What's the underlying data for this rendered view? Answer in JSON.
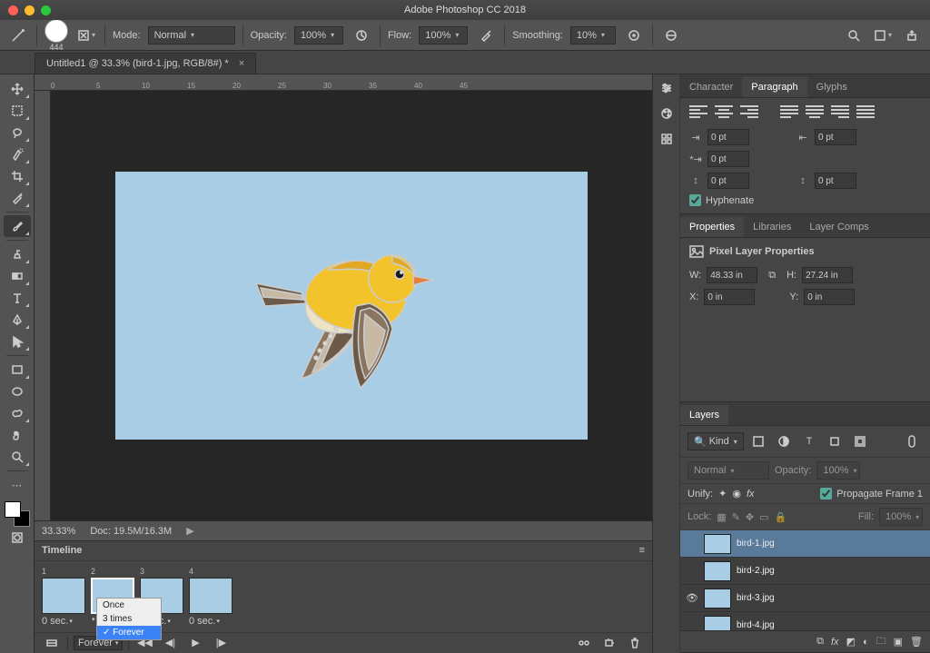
{
  "app": {
    "title": "Adobe Photoshop CC 2018"
  },
  "document": {
    "tab_title": "Untitled1 @ 33.3% (bird-1.jpg, RGB/8#) *"
  },
  "options": {
    "brush_size": "444",
    "mode_label": "Mode:",
    "mode_value": "Normal",
    "opacity_label": "Opacity:",
    "opacity_value": "100%",
    "flow_label": "Flow:",
    "flow_value": "100%",
    "smoothing_label": "Smoothing:",
    "smoothing_value": "10%"
  },
  "ruler_marks": [
    "0",
    "5",
    "10",
    "15",
    "20",
    "25",
    "30",
    "35",
    "40",
    "45"
  ],
  "status": {
    "zoom": "33.33%",
    "doc": "Doc: 19.5M/16.3M"
  },
  "timeline": {
    "title": "Timeline",
    "frames": [
      {
        "n": "1",
        "dur": "0 sec."
      },
      {
        "n": "2",
        "dur": ""
      },
      {
        "n": "3",
        "dur": "0 sec."
      },
      {
        "n": "4",
        "dur": "0 sec."
      }
    ],
    "loop_options": [
      "Once",
      "3 times",
      "Forever"
    ],
    "loop_selected": "Forever"
  },
  "paragraph": {
    "tab_character": "Character",
    "tab_paragraph": "Paragraph",
    "tab_glyphs": "Glyphs",
    "indent_left": "0 pt",
    "indent_right": "0 pt",
    "indent_first": "0 pt",
    "space_before": "0 pt",
    "space_after": "0 pt",
    "hyphenate_label": "Hyphenate"
  },
  "properties": {
    "tab_properties": "Properties",
    "tab_libraries": "Libraries",
    "tab_layer_comps": "Layer Comps",
    "header": "Pixel Layer Properties",
    "w_label": "W:",
    "w_value": "48.33 in",
    "h_label": "H:",
    "h_value": "27.24 in",
    "x_label": "X:",
    "x_value": "0 in",
    "y_label": "Y:",
    "y_value": "0 in"
  },
  "layers": {
    "title": "Layers",
    "filter": "Kind",
    "blend": "Normal",
    "opacity_label": "Opacity:",
    "opacity_value": "100%",
    "unify_label": "Unify:",
    "propagate_label": "Propagate Frame 1",
    "lock_label": "Lock:",
    "fill_label": "Fill:",
    "fill_value": "100%",
    "items": [
      {
        "name": "bird-1.jpg",
        "visible": false,
        "selected": true
      },
      {
        "name": "bird-2.jpg",
        "visible": false,
        "selected": false
      },
      {
        "name": "bird-3.jpg",
        "visible": true,
        "selected": false
      },
      {
        "name": "bird-4.jpg",
        "visible": false,
        "selected": false
      }
    ]
  }
}
